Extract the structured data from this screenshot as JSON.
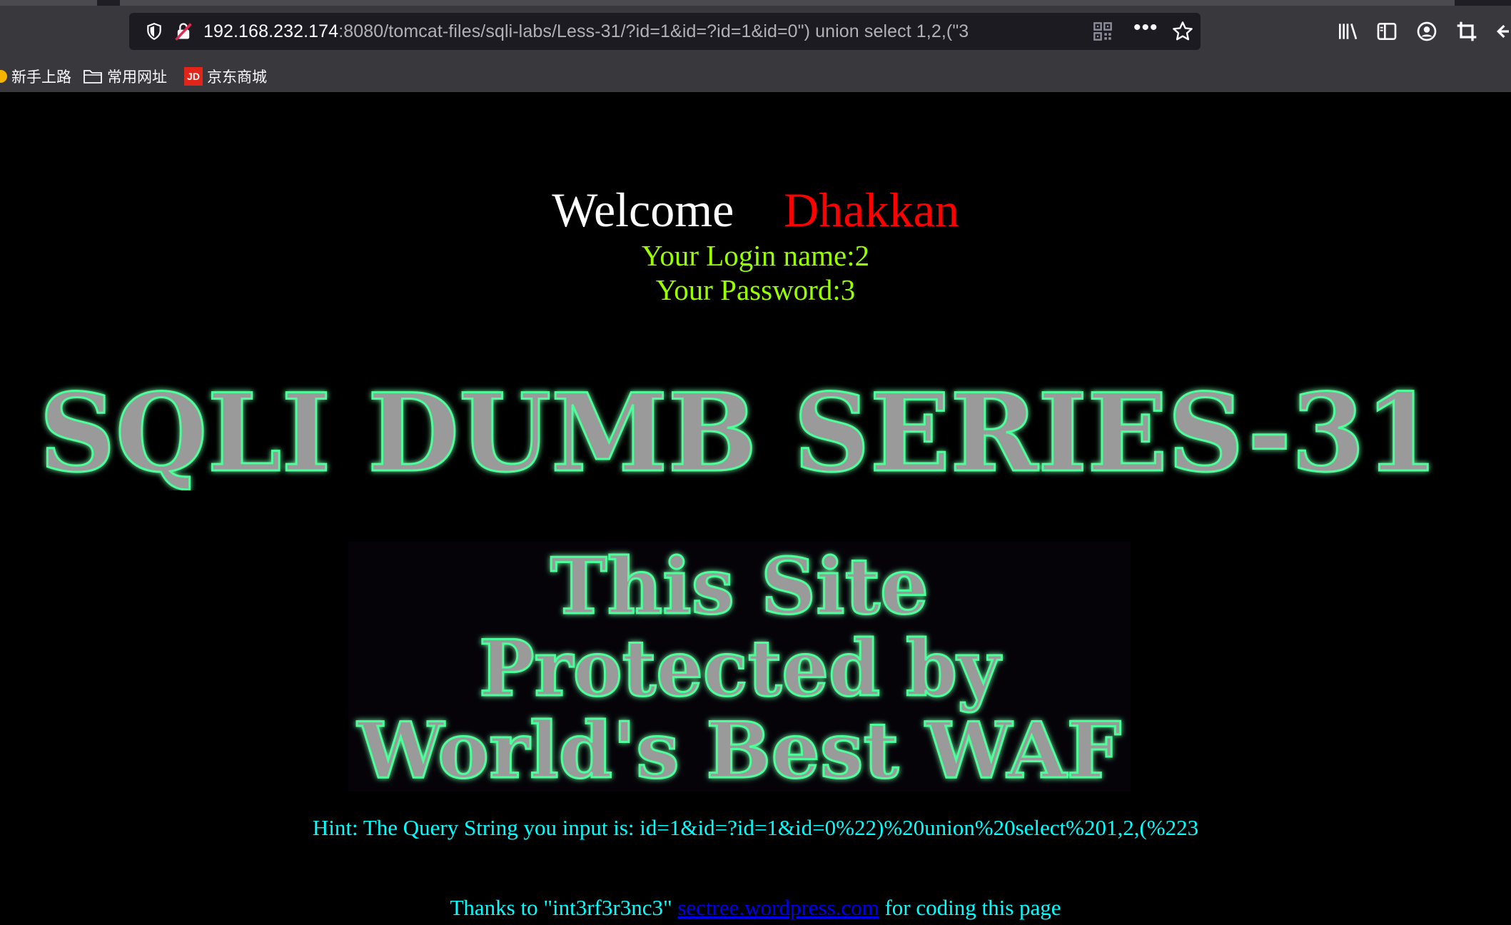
{
  "browser": {
    "url_host": "192.168.232.174",
    "url_rest": ":8080/tomcat-files/sqli-labs/Less-31/?id=1&id=?id=1&id=0\") union select 1,2,(\"3",
    "more_glyph": "•••",
    "bookmarks": [
      {
        "label": "新手上路",
        "icon": "firefox-dot-icon"
      },
      {
        "label": "常用网址",
        "icon": "folder-icon"
      },
      {
        "label": "京东商城",
        "icon": "jd-logo-icon",
        "badge": "JD"
      }
    ],
    "toolbar_icons": [
      "library-icon",
      "sidebar-icon",
      "account-icon",
      "crop-icon",
      "back-icon"
    ]
  },
  "page": {
    "welcome": "Welcome",
    "name": "Dhakkan",
    "login_line": "Your Login name:2",
    "password_line": "Your Password:3",
    "title_banner": "SQLI DUMB SERIES-31",
    "waf_banner": [
      "This Site",
      "Protected by",
      "World's Best WAF"
    ],
    "hint": "Hint: The Query String you input is: id=1&id=?id=1&id=0%22)%20union%20select%201,2,(%223",
    "thanks_prefix": "Thanks to \"int3rf3r3nc3\" ",
    "thanks_link": "sectree.wordpress.com",
    "thanks_suffix": " for coding this page"
  },
  "colors": {
    "welcome": "#ffffff",
    "name": "#ff0000",
    "credentials": "#99ff00",
    "hint": "#00ffff",
    "link": "#0000ee",
    "banner_glow": "#4dff9a"
  }
}
